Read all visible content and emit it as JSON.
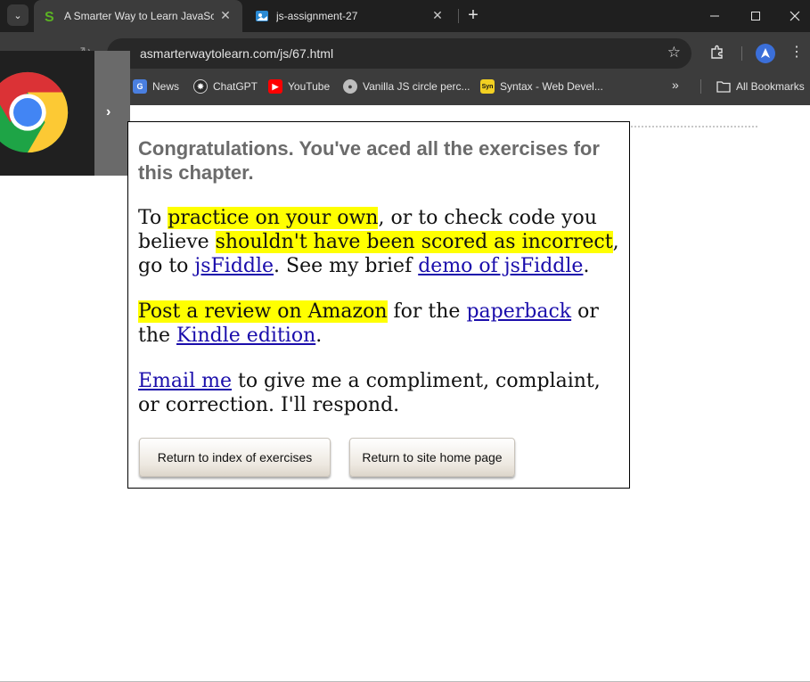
{
  "browser": {
    "tabs": [
      {
        "title": "A Smarter Way to Learn JavaScript",
        "active": true
      },
      {
        "title": "js-assignment-27",
        "active": false
      }
    ],
    "url": "asmarterwaytolearn.com/js/67.html",
    "bookmarks": [
      {
        "label": "News",
        "icon": "news-icon"
      },
      {
        "label": "ChatGPT",
        "icon": "chatgpt-icon"
      },
      {
        "label": "YouTube",
        "icon": "youtube-icon"
      },
      {
        "label": "Vanilla JS circle perc...",
        "icon": "globe-icon"
      },
      {
        "label": "Syntax - Web Devel...",
        "icon": "syntax-icon"
      }
    ],
    "all_bookmarks_label": "All Bookmarks"
  },
  "content": {
    "heading": "Congratulations. You've aced all the exercises for this chapter.",
    "p1": {
      "t1": "To ",
      "h1": "practice on your own",
      "t2": ", or to check code you believe ",
      "h2": "shouldn't have been scored as incorrect",
      "t3": ", go to ",
      "link1": "jsFiddle",
      "t4": ". See my brief ",
      "link2": "demo of jsFiddle",
      "t5": "."
    },
    "p2": {
      "h1": "Post a review on Amazon",
      "t1": " for the ",
      "link1": "paperback",
      "t2": " or the ",
      "link2": "Kindle edition",
      "t3": "."
    },
    "p3": {
      "link1": "Email me",
      "t1": " to give me a compliment, complaint, or correction. I'll respond."
    },
    "buttons": {
      "index": "Return to index of exercises",
      "home": "Return to site home page"
    }
  }
}
